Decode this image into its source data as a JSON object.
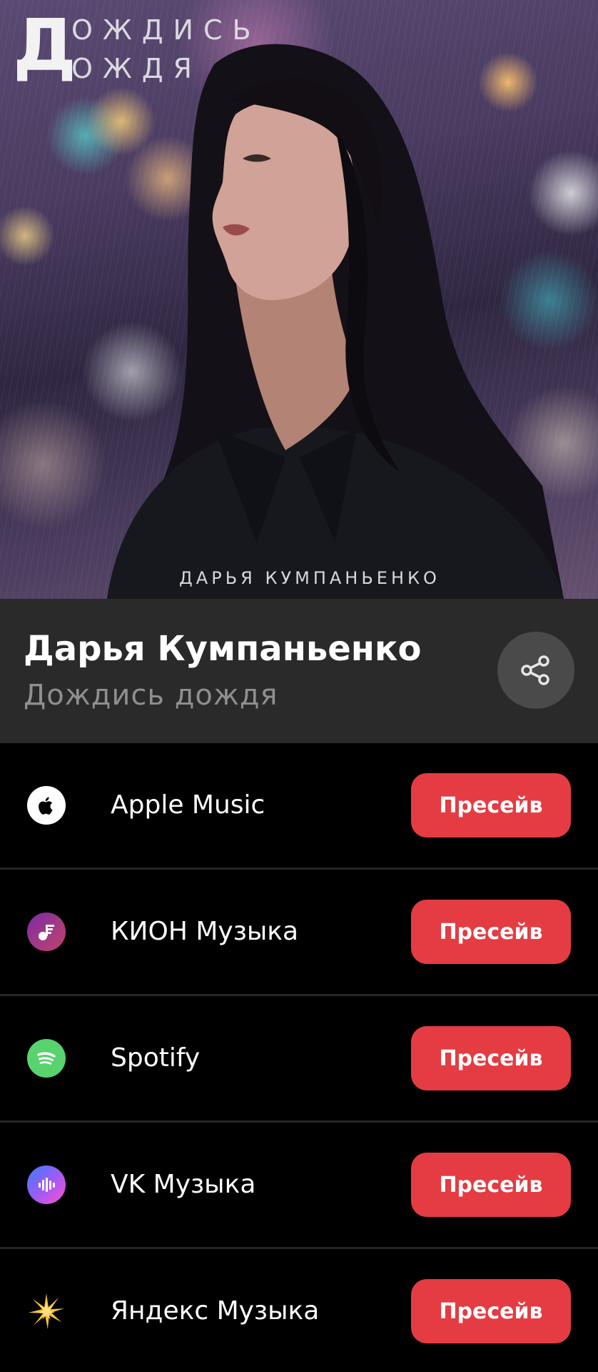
{
  "cover": {
    "title_initial": "Д",
    "title_line1": "ОЖДИСЬ",
    "title_line2": "ОЖДЯ",
    "artist_caption": "ДАРЬЯ КУМПАНЬЕНКО"
  },
  "header": {
    "artist": "Дарья Кумпаньенко",
    "track": "Дождись дождя",
    "share_icon": "share-icon"
  },
  "platforms": [
    {
      "name": "Apple Music",
      "icon": "apple-icon",
      "button": "Пресейв"
    },
    {
      "name": "КИОН Музыка",
      "icon": "kion-music-icon",
      "button": "Пресейв"
    },
    {
      "name": "Spotify",
      "icon": "spotify-icon",
      "button": "Пресейв"
    },
    {
      "name": "VK Музыка",
      "icon": "vk-music-icon",
      "button": "Пресейв"
    },
    {
      "name": "Яндекс Музыка",
      "icon": "yandex-music-icon",
      "button": "Пресейв"
    }
  ],
  "colors": {
    "header_bg": "#2a2a2a",
    "button": "#e43c42",
    "subtitle": "#8f8f8f",
    "divider": "#262626"
  }
}
